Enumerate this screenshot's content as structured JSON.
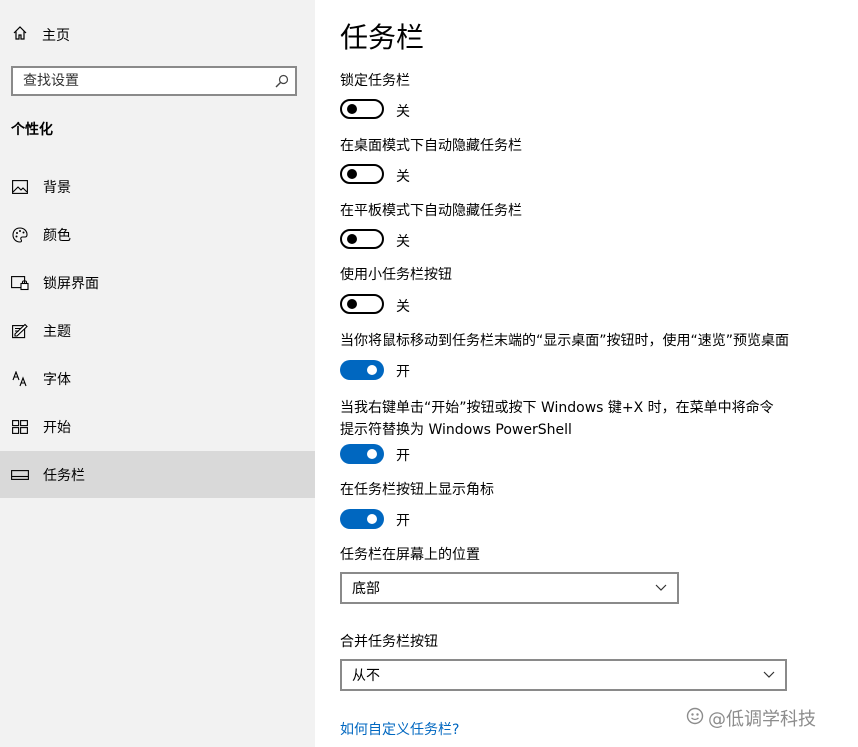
{
  "sidebar": {
    "home_label": "主页",
    "search_placeholder": "查找设置",
    "section_title": "个性化",
    "items": [
      {
        "label": "背景",
        "icon": "image-icon"
      },
      {
        "label": "颜色",
        "icon": "palette-icon"
      },
      {
        "label": "锁屏界面",
        "icon": "lock-screen-icon"
      },
      {
        "label": "主题",
        "icon": "theme-icon"
      },
      {
        "label": "字体",
        "icon": "font-icon"
      },
      {
        "label": "开始",
        "icon": "start-icon"
      },
      {
        "label": "任务栏",
        "icon": "taskbar-icon",
        "selected": true
      }
    ]
  },
  "main": {
    "title": "任务栏",
    "settings": [
      {
        "label": "锁定任务栏",
        "state": "关",
        "on": false
      },
      {
        "label": "在桌面模式下自动隐藏任务栏",
        "state": "关",
        "on": false
      },
      {
        "label": "在平板模式下自动隐藏任务栏",
        "state": "关",
        "on": false
      },
      {
        "label": "使用小任务栏按钮",
        "state": "关",
        "on": false
      },
      {
        "label": "当你将鼠标移动到任务栏末端的“显示桌面”按钮时，使用“速览”预览桌面",
        "state": "开",
        "on": true
      },
      {
        "label": "当我右键单击“开始”按钮或按下 Windows 键+X 时，在菜单中将命令提示符替换为 Windows PowerShell",
        "state": "开",
        "on": true
      },
      {
        "label": "在任务栏按钮上显示角标",
        "state": "开",
        "on": true
      }
    ],
    "position": {
      "label": "任务栏在屏幕上的位置",
      "value": "底部"
    },
    "combine": {
      "label": "合并任务栏按钮",
      "value": "从不"
    },
    "help_link": "如何自定义任务栏?"
  },
  "watermark": "@低调学科技",
  "colors": {
    "accent": "#0067c0",
    "sidebar_bg": "#f2f2f2",
    "selected_bg": "#d9d9d9"
  }
}
